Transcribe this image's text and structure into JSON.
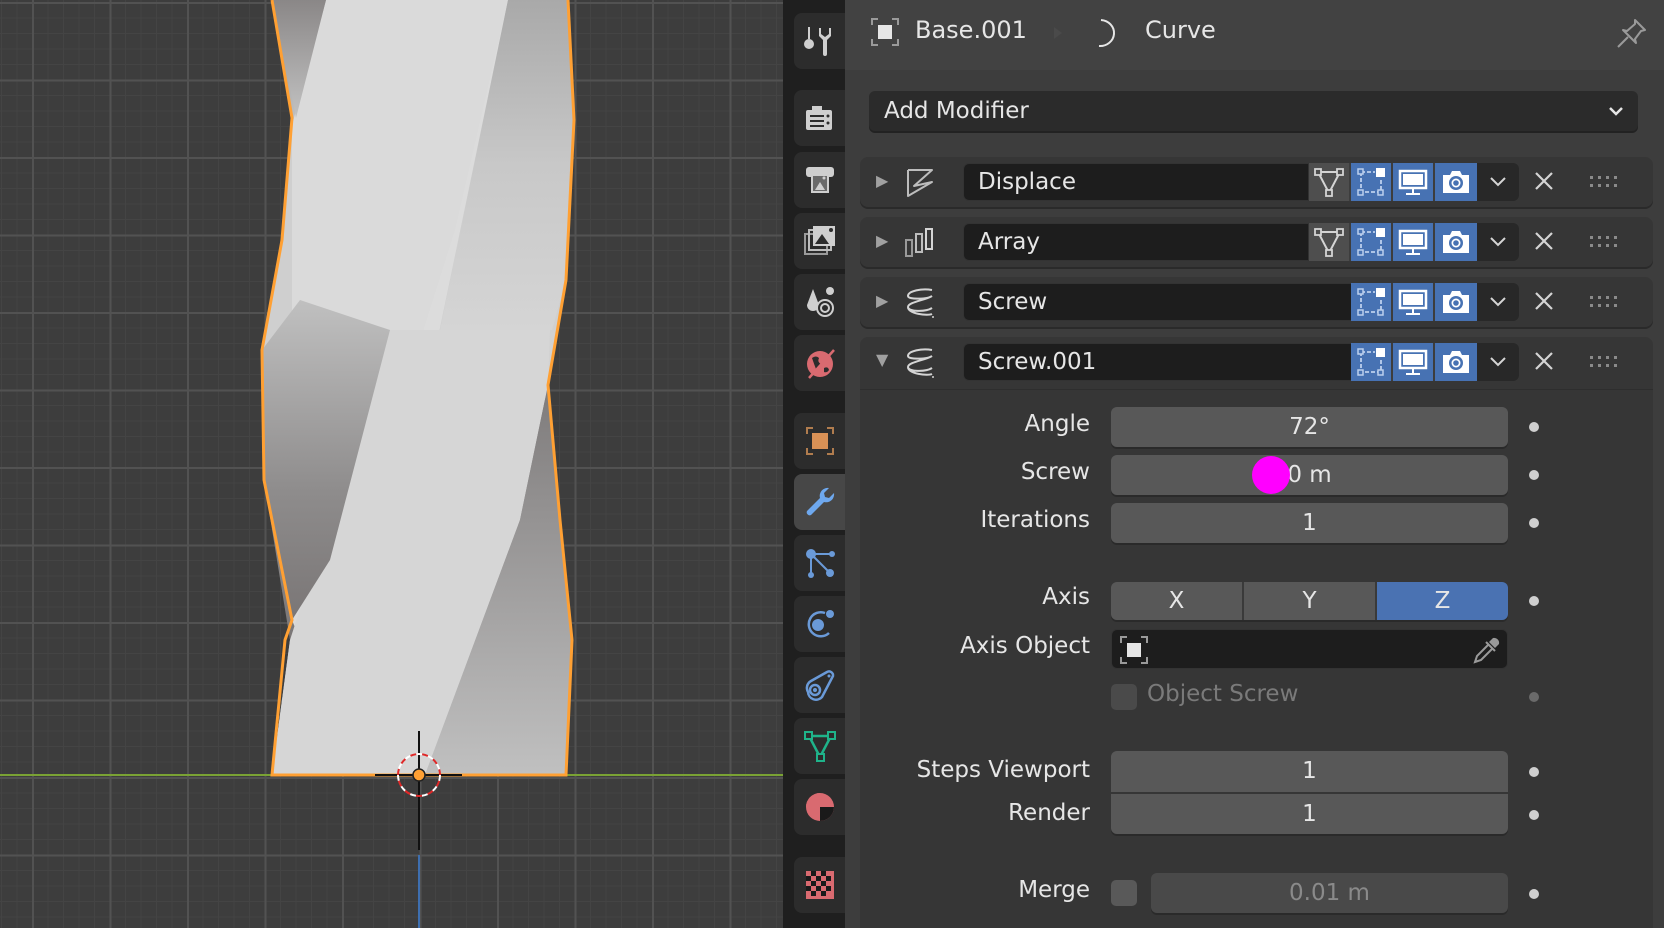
{
  "viewport": {
    "object_name": "Base.001",
    "selection_color": "#ffa033",
    "x_axis_color": "#7aa234",
    "z_axis_color": "#3e6fb0"
  },
  "tabs": [
    {
      "name": "tool",
      "icon": "tool-icon"
    },
    {
      "name": "render",
      "icon": "render-icon"
    },
    {
      "name": "output",
      "icon": "output-icon"
    },
    {
      "name": "view-layer",
      "icon": "view-layer-icon"
    },
    {
      "name": "scene",
      "icon": "scene-icon"
    },
    {
      "name": "world",
      "icon": "world-icon"
    },
    {
      "name": "object",
      "icon": "object-icon"
    },
    {
      "name": "modifiers",
      "icon": "wrench-icon",
      "active": true
    },
    {
      "name": "particles",
      "icon": "particles-icon"
    },
    {
      "name": "physics",
      "icon": "physics-icon"
    },
    {
      "name": "constraints",
      "icon": "constraints-icon"
    },
    {
      "name": "data",
      "icon": "mesh-data-icon"
    },
    {
      "name": "material",
      "icon": "material-icon"
    },
    {
      "name": "texture",
      "icon": "texture-icon"
    }
  ],
  "header": {
    "object": "Base.001",
    "data": "Curve"
  },
  "add_modifier": {
    "label": "Add Modifier"
  },
  "modifiers": [
    {
      "name": "Displace",
      "icon": "displace-icon",
      "expanded": false,
      "edit_mode": true,
      "on_cage": true,
      "realtime": true,
      "render": true
    },
    {
      "name": "Array",
      "icon": "array-icon",
      "expanded": false,
      "edit_mode": true,
      "on_cage": true,
      "realtime": true,
      "render": true
    },
    {
      "name": "Screw",
      "icon": "screw-icon",
      "expanded": false,
      "on_cage": true,
      "realtime": true,
      "render": true
    },
    {
      "name": "Screw.001",
      "icon": "screw-icon",
      "expanded": true,
      "on_cage": true,
      "realtime": true,
      "render": true
    }
  ],
  "screw_settings": {
    "angle": {
      "label": "Angle",
      "value": "72°"
    },
    "screw": {
      "label": "Screw",
      "value": "0 m"
    },
    "iterations": {
      "label": "Iterations",
      "value": "1"
    },
    "axis": {
      "label": "Axis",
      "options": [
        "X",
        "Y",
        "Z"
      ],
      "selected": "Z"
    },
    "axis_object": {
      "label": "Axis Object",
      "value": ""
    },
    "object_screw": {
      "label": "Object Screw",
      "checked": false
    },
    "steps_viewport": {
      "label": "Steps Viewport",
      "value": "1"
    },
    "render": {
      "label": "Render",
      "value": "1"
    },
    "merge": {
      "label": "Merge",
      "checked": false,
      "value": "0.01 m"
    }
  },
  "colors": {
    "accent_blue": "#4772b3",
    "cursor_marker": "#ff00ff"
  }
}
